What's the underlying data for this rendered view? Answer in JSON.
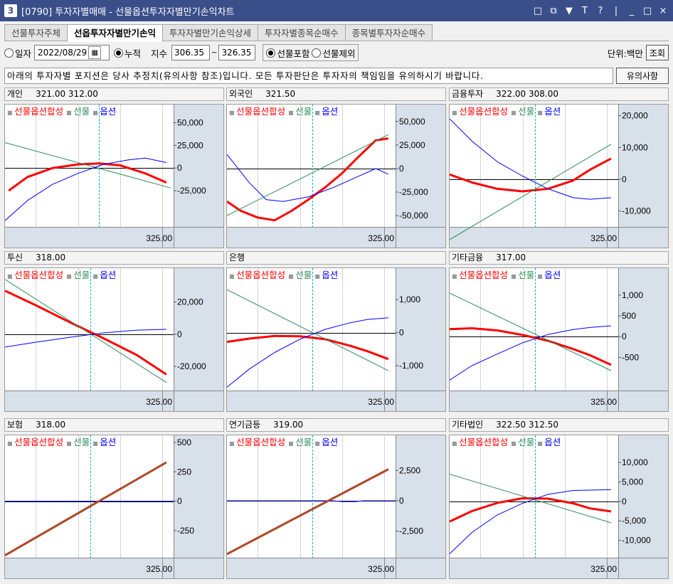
{
  "window": {
    "badge": "3",
    "title": "[0790] 투자자별매매 - 선물옵션투자자별만기손익차트",
    "controls": [
      "□",
      "⧉",
      "▼",
      "T",
      "?",
      "|",
      "_",
      "□",
      "×"
    ]
  },
  "tabs": [
    "선물투자주체",
    "선옵투자자별만기손익",
    "투자자별만기손익상세",
    "투자자별종목순매수",
    "종목별투자자순매수"
  ],
  "controls": {
    "daily_label": "일자",
    "date_value": "2022/08/29",
    "cumulative_label": "누적",
    "index_label": "지수",
    "index_from": "306.35",
    "tilde": "~",
    "index_to": "326.35",
    "include_futures": "선물포함",
    "exclude_futures": "선물제외",
    "unit_label": "단위:백만",
    "query_button": "조회"
  },
  "notice": {
    "text": "아래의 투자자별 포지션은 당사 추정치(유의사항 참조)입니다. 모든 투자판단은 투자자의 책임임을 유의하시기 바랍니다.",
    "button": "유의사항"
  },
  "legend": {
    "combined": "선물옵션합성",
    "futures": "선물",
    "options": "옵션",
    "marker": "■"
  },
  "colors": {
    "combined": "#ff0000",
    "futures": "#2e8b57",
    "options": "#0000ff",
    "dashed": "#00b4c8",
    "axis_bg": "#d8e0ea",
    "titlebar": "#3a4f8a"
  },
  "chart_data": [
    {
      "type": "line",
      "title": "개인",
      "header_values": [
        "321.00",
        "312.00"
      ],
      "x_label": "325.00",
      "x": [
        306.35,
        326.35
      ],
      "ylim": [
        -65000,
        70000
      ],
      "yticks": [
        "50,000",
        "25,000",
        "0",
        "-25,000"
      ],
      "yvals": [
        50000,
        25000,
        0,
        -25000
      ],
      "marker_x": 317.5,
      "series": [
        {
          "name": "선물옵션합성",
          "values": [
            [
              306.8,
              -25000
            ],
            [
              309,
              -10000
            ],
            [
              312,
              0
            ],
            [
              315,
              4000
            ],
            [
              317.5,
              5000
            ],
            [
              320,
              3000
            ],
            [
              323,
              -6000
            ],
            [
              325.5,
              -16000
            ]
          ]
        },
        {
          "name": "선물",
          "values": [
            [
              306.35,
              28000
            ],
            [
              326,
              -22000
            ]
          ]
        },
        {
          "name": "옵션",
          "values": [
            [
              306.35,
              -58000
            ],
            [
              309,
              -36000
            ],
            [
              312,
              -18000
            ],
            [
              315,
              -6000
            ],
            [
              318,
              4000
            ],
            [
              321,
              9000
            ],
            [
              323,
              11000
            ],
            [
              325.5,
              6000
            ]
          ]
        }
      ]
    },
    {
      "type": "line",
      "title": "외국인",
      "header_values": [
        "321.50"
      ],
      "x_label": "325.00",
      "x": [
        306.35,
        326.35
      ],
      "ylim": [
        -62000,
        68000
      ],
      "yticks": [
        "50,000",
        "25,000",
        "0",
        "-25,000",
        "-50,000"
      ],
      "yvals": [
        50000,
        25000,
        0,
        -25000,
        -50000
      ],
      "marker_x": 316.5,
      "series": [
        {
          "name": "선물옵션합성",
          "values": [
            [
              306.35,
              -35000
            ],
            [
              308,
              -45000
            ],
            [
              310,
              -52000
            ],
            [
              312,
              -55000
            ],
            [
              314,
              -45000
            ],
            [
              316,
              -33000
            ],
            [
              318,
              -20000
            ],
            [
              320,
              -5000
            ],
            [
              322,
              13000
            ],
            [
              324,
              30000
            ],
            [
              325.5,
              32000
            ]
          ]
        },
        {
          "name": "선물",
          "values": [
            [
              306.35,
              -50000
            ],
            [
              325.5,
              36000
            ]
          ]
        },
        {
          "name": "옵션",
          "values": [
            [
              306.35,
              15000
            ],
            [
              309,
              -15000
            ],
            [
              311,
              -33000
            ],
            [
              313,
              -35000
            ],
            [
              316,
              -30000
            ],
            [
              319,
              -20000
            ],
            [
              322,
              -8000
            ],
            [
              324,
              0
            ],
            [
              325.5,
              -6000
            ]
          ]
        }
      ]
    },
    {
      "type": "line",
      "title": "금융투자",
      "header_values": [
        "322.00",
        "308.00"
      ],
      "x_label": "325.00",
      "x": [
        306.35,
        326.35
      ],
      "ylim": [
        -15000,
        23500
      ],
      "yticks": [
        "20,000",
        "10,000",
        "0",
        "-10,000"
      ],
      "yvals": [
        20000,
        10000,
        0,
        -10000
      ],
      "marker_x": 316.5,
      "series": [
        {
          "name": "선물옵션합성",
          "values": [
            [
              306.35,
              1500
            ],
            [
              309,
              -1000
            ],
            [
              312,
              -3000
            ],
            [
              315,
              -3800
            ],
            [
              318,
              -3000
            ],
            [
              321,
              -400
            ],
            [
              323,
              3000
            ],
            [
              325.5,
              6500
            ]
          ]
        },
        {
          "name": "선물",
          "values": [
            [
              306.35,
              -19000
            ],
            [
              325.5,
              11000
            ]
          ]
        },
        {
          "name": "옵션",
          "values": [
            [
              306.35,
              19000
            ],
            [
              309,
              12000
            ],
            [
              312,
              5500
            ],
            [
              315,
              1000
            ],
            [
              318,
              -3000
            ],
            [
              321,
              -5800
            ],
            [
              323,
              -6300
            ],
            [
              325.5,
              -5800
            ]
          ]
        }
      ]
    },
    {
      "type": "line",
      "title": "투신",
      "header_values": [
        "318.00"
      ],
      "x_label": "325.00",
      "x": [
        306.35,
        326.35
      ],
      "ylim": [
        -35000,
        41000
      ],
      "yticks": [
        "20,000",
        "0",
        "-20,000"
      ],
      "yvals": [
        20000,
        0,
        -20000
      ],
      "marker_x": 316.5,
      "series": [
        {
          "name": "선물옵션합성",
          "values": [
            [
              306.35,
              27000
            ],
            [
              310,
              18000
            ],
            [
              314,
              7500
            ],
            [
              318,
              -2500
            ],
            [
              322,
              -13000
            ],
            [
              325.5,
              -25000
            ]
          ]
        },
        {
          "name": "선물",
          "values": [
            [
              306.35,
              34000
            ],
            [
              325.5,
              -30000
            ]
          ]
        },
        {
          "name": "옵션",
          "values": [
            [
              306.35,
              -8000
            ],
            [
              310,
              -5000
            ],
            [
              314,
              -2000
            ],
            [
              318,
              800
            ],
            [
              322,
              2500
            ],
            [
              325.5,
              3000
            ]
          ]
        }
      ]
    },
    {
      "type": "line",
      "title": "은행",
      "header_values": [],
      "x_label": "325.00",
      "x": [
        306.35,
        326.35
      ],
      "ylim": [
        -1750,
        1950
      ],
      "yticks": [
        "1,000",
        "0",
        "-1,000"
      ],
      "yvals": [
        1000,
        0,
        -1000
      ],
      "marker_x": 316.5,
      "series": [
        {
          "name": "선물옵션합성",
          "values": [
            [
              306.35,
              -280
            ],
            [
              309,
              -180
            ],
            [
              312,
              -100
            ],
            [
              315,
              -110
            ],
            [
              318,
              -200
            ],
            [
              321,
              -400
            ],
            [
              323,
              -560
            ],
            [
              325.5,
              -800
            ]
          ]
        },
        {
          "name": "선물",
          "values": [
            [
              306.35,
              1300
            ],
            [
              325.5,
              -1150
            ]
          ]
        },
        {
          "name": "옵션",
          "values": [
            [
              306.35,
              -1650
            ],
            [
              309,
              -1100
            ],
            [
              312,
              -600
            ],
            [
              315,
              -200
            ],
            [
              318,
              100
            ],
            [
              321,
              300
            ],
            [
              323,
              400
            ],
            [
              325.5,
              450
            ]
          ]
        }
      ]
    },
    {
      "type": "line",
      "title": "기타금융",
      "header_values": [
        "317.00"
      ],
      "x_label": "325.00",
      "x": [
        306.35,
        326.35
      ],
      "ylim": [
        -1300,
        1650
      ],
      "yticks": [
        "1,000",
        "500",
        "0",
        "-500"
      ],
      "yvals": [
        1000,
        500,
        0,
        -500
      ],
      "marker_x": 316.5,
      "series": [
        {
          "name": "선물옵션합성",
          "values": [
            [
              306.35,
              180
            ],
            [
              309,
              200
            ],
            [
              312,
              150
            ],
            [
              315,
              40
            ],
            [
              318,
              -100
            ],
            [
              321,
              -300
            ],
            [
              323,
              -450
            ],
            [
              325.5,
              -680
            ]
          ]
        },
        {
          "name": "선물",
          "values": [
            [
              306.35,
              1050
            ],
            [
              325.5,
              -820
            ]
          ]
        },
        {
          "name": "옵션",
          "values": [
            [
              306.35,
              -1050
            ],
            [
              309,
              -700
            ],
            [
              312,
              -420
            ],
            [
              315,
              -150
            ],
            [
              318,
              50
            ],
            [
              321,
              170
            ],
            [
              323,
              220
            ],
            [
              325.5,
              260
            ]
          ]
        }
      ]
    },
    {
      "type": "line",
      "title": "보험",
      "header_values": [
        "318.00"
      ],
      "x_label": "325.00",
      "x": [
        306.35,
        326.35
      ],
      "ylim": [
        -480,
        560
      ],
      "yticks": [
        "500",
        "250",
        "0",
        "-250"
      ],
      "yvals": [
        500,
        250,
        0,
        -250
      ],
      "marker_x": 316.5,
      "series": [
        {
          "name": "선물옵션합성",
          "values": [
            [
              306.35,
              -460
            ],
            [
              325.5,
              330
            ]
          ]
        },
        {
          "name": "선물",
          "values": [
            [
              306.35,
              -460
            ],
            [
              325.5,
              330
            ]
          ]
        },
        {
          "name": "옵션",
          "values": [
            [
              306.35,
              0
            ],
            [
              326.35,
              0
            ]
          ]
        }
      ]
    },
    {
      "type": "line",
      "title": "연기금등",
      "header_values": [
        "319.00"
      ],
      "x_label": "325.00",
      "x": [
        306.35,
        326.35
      ],
      "ylim": [
        -4700,
        5400
      ],
      "yticks": [
        "2,500",
        "0",
        "-2,500"
      ],
      "yvals": [
        2500,
        0,
        -2500
      ],
      "marker_x": 316.5,
      "series": [
        {
          "name": "선물옵션합성",
          "values": [
            [
              306.35,
              -4400
            ],
            [
              325.5,
              2600
            ]
          ]
        },
        {
          "name": "선물",
          "values": [
            [
              306.35,
              -4400
            ],
            [
              325.5,
              2600
            ]
          ]
        },
        {
          "name": "옵션",
          "values": [
            [
              306.35,
              0
            ],
            [
              319,
              0
            ],
            [
              320,
              -70
            ],
            [
              321.5,
              -70
            ],
            [
              322.5,
              0
            ],
            [
              326.35,
              0
            ]
          ]
        }
      ]
    },
    {
      "type": "line",
      "title": "기타법인",
      "header_values": [
        "322.50",
        "312.50"
      ],
      "x_label": "325.00",
      "x": [
        306.35,
        326.35
      ],
      "ylim": [
        -14500,
        17000
      ],
      "yticks": [
        "10,000",
        "5,000",
        "0",
        "-5,000",
        "-10,000"
      ],
      "yvals": [
        10000,
        5000,
        0,
        -5000,
        -10000
      ],
      "marker_x": 316.5,
      "series": [
        {
          "name": "선물옵션합성",
          "values": [
            [
              306.35,
              -5200
            ],
            [
              309,
              -2500
            ],
            [
              312,
              -400
            ],
            [
              315,
              800
            ],
            [
              318,
              700
            ],
            [
              321,
              -500
            ],
            [
              323,
              -1800
            ],
            [
              325.5,
              -2600
            ]
          ]
        },
        {
          "name": "선물",
          "values": [
            [
              306.35,
              7000
            ],
            [
              325.5,
              -5500
            ]
          ]
        },
        {
          "name": "옵션",
          "values": [
            [
              306.35,
              -13500
            ],
            [
              309,
              -8000
            ],
            [
              312,
              -3500
            ],
            [
              315,
              -500
            ],
            [
              318,
              1800
            ],
            [
              321,
              2800
            ],
            [
              323,
              2900
            ],
            [
              325.5,
              3000
            ]
          ]
        }
      ]
    }
  ]
}
